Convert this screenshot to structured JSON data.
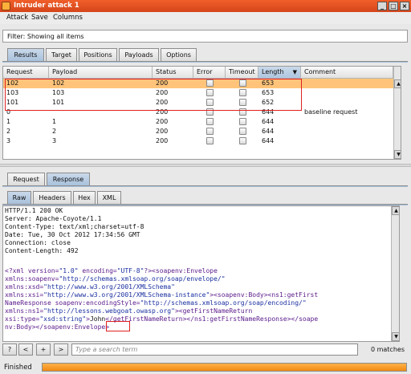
{
  "window": {
    "title": "Intruder attack 1",
    "min": "_",
    "max": "□",
    "close": "×"
  },
  "menu": [
    "Attack",
    "Save",
    "Columns"
  ],
  "filter": {
    "text": "Filter: Showing all items"
  },
  "top_tabs": [
    {
      "label": "Results",
      "active": true
    },
    {
      "label": "Target",
      "active": false
    },
    {
      "label": "Positions",
      "active": false
    },
    {
      "label": "Payloads",
      "active": false
    },
    {
      "label": "Options",
      "active": false
    }
  ],
  "table": {
    "columns": [
      "Request",
      "Payload",
      "Status",
      "Error",
      "Timeout",
      "Length",
      "Comment"
    ],
    "sort_indicator": "▼",
    "rows": [
      {
        "request": "102",
        "payload": "102",
        "status": "200",
        "length": "653",
        "comment": "",
        "selected": true
      },
      {
        "request": "103",
        "payload": "103",
        "status": "200",
        "length": "653",
        "comment": "",
        "selected": false
      },
      {
        "request": "101",
        "payload": "101",
        "status": "200",
        "length": "652",
        "comment": "",
        "selected": false
      },
      {
        "request": "0",
        "payload": "",
        "status": "200",
        "length": "644",
        "comment": "baseline request",
        "selected": false
      },
      {
        "request": "1",
        "payload": "1",
        "status": "200",
        "length": "644",
        "comment": "",
        "selected": false
      },
      {
        "request": "2",
        "payload": "2",
        "status": "200",
        "length": "644",
        "comment": "",
        "selected": false
      },
      {
        "request": "3",
        "payload": "3",
        "status": "200",
        "length": "644",
        "comment": "",
        "selected": false
      }
    ]
  },
  "reqresp_tabs": [
    {
      "label": "Request",
      "active": false
    },
    {
      "label": "Response",
      "active": true
    }
  ],
  "view_tabs": [
    {
      "label": "Raw",
      "active": true
    },
    {
      "label": "Headers",
      "active": false
    },
    {
      "label": "Hex",
      "active": false
    },
    {
      "label": "XML",
      "active": false
    }
  ],
  "response": {
    "headers": [
      "HTTP/1.1 200 OK",
      "Server: Apache-Coyote/1.1",
      "Content-Type: text/xml;charset=utf-8",
      "Date: Tue, 30 Oct 2012 17:34:56 GMT",
      "Connection: close",
      "Content-Length: 492"
    ],
    "xml_lines": [
      [
        [
          "k",
          "<?xml version="
        ],
        [
          "s",
          "\"1.0\""
        ],
        [
          "k",
          " encoding="
        ],
        [
          "s",
          "\"UTF-8\""
        ],
        [
          "k",
          "?><soapenv:Envelope"
        ]
      ],
      [
        [
          "k",
          "xmlns:soapenv="
        ],
        [
          "s",
          "\"http://schemas.xmlsoap.org/soap/envelope/\""
        ]
      ],
      [
        [
          "k",
          "xmlns:xsd="
        ],
        [
          "s",
          "\"http://www.w3.org/2001/XMLSchema\""
        ]
      ],
      [
        [
          "k",
          "xmlns:xsi="
        ],
        [
          "s",
          "\"http://www.w3.org/2001/XMLSchema-instance\""
        ],
        [
          "k",
          "><soapenv:Body><ns1:getFirst"
        ]
      ],
      [
        [
          "k",
          "NameResponse soapenv:encodingStyle="
        ],
        [
          "s",
          "\"http://schemas.xmlsoap.org/soap/encoding/\""
        ]
      ],
      [
        [
          "k",
          "xmlns:ns1="
        ],
        [
          "s",
          "\"http://lessons.webgoat.owasp.org\""
        ],
        [
          "k",
          "><getFirstNameReturn"
        ]
      ],
      [
        [
          "k",
          "xsi:type="
        ],
        [
          "s",
          "\"xsd:string\""
        ],
        [
          "k",
          ">"
        ],
        [
          "t",
          "John"
        ],
        [
          "k",
          "</getFirstNameReturn></ns1:getFirstNameResponse></soape"
        ]
      ],
      [
        [
          "k",
          "nv:Body></soapenv:Envelope>"
        ]
      ]
    ]
  },
  "search": {
    "btn_help": "?",
    "btn_prev": "<",
    "btn_add": "+",
    "btn_next": ">",
    "placeholder": "Type a search term",
    "matches": "0 matches"
  },
  "status": {
    "label": "Finished",
    "progress": 1.0
  }
}
